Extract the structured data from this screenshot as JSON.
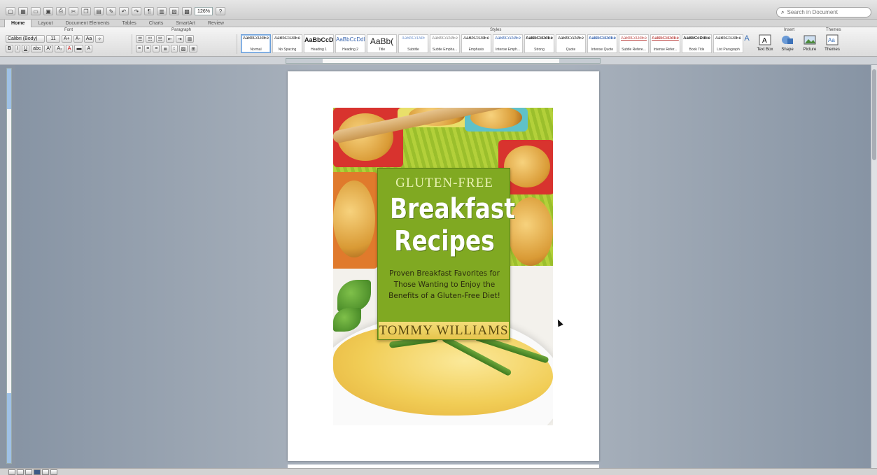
{
  "toolbar": {
    "zoom": "126%"
  },
  "search": {
    "placeholder": "Search in Document"
  },
  "ribbon": {
    "tabs": [
      "Home",
      "Layout",
      "Document Elements",
      "Tables",
      "Charts",
      "SmartArt",
      "Review"
    ],
    "groups": {
      "font": "Font",
      "paragraph": "Paragraph",
      "styles": "Styles",
      "insert": "Insert",
      "themes": "Themes"
    },
    "font_name": "Calibri (Body)",
    "font_size": "11",
    "styles": [
      {
        "sample": "AaBbCcDdEe",
        "name": "Normal"
      },
      {
        "sample": "AaBbCcDdEe",
        "name": "No Spacing"
      },
      {
        "sample": "AaBbCcDc",
        "name": "Heading 1"
      },
      {
        "sample": "AaBbCcDdI",
        "name": "Heading 2"
      },
      {
        "sample": "AaBb(",
        "name": "Title"
      },
      {
        "sample": "AaBbCcDdE",
        "name": "Subtitle"
      },
      {
        "sample": "AaBbCcDdEe",
        "name": "Subtle Empha..."
      },
      {
        "sample": "AaBbCcDdEe",
        "name": "Emphasis"
      },
      {
        "sample": "AaBbCcDdEe",
        "name": "Intense Emph..."
      },
      {
        "sample": "AaBbCcDdEe",
        "name": "Strong"
      },
      {
        "sample": "AaBbCcDdEe",
        "name": "Quote"
      },
      {
        "sample": "AaBbCcDdEe",
        "name": "Intense Quote"
      },
      {
        "sample": "AaBbCcDdEe",
        "name": "Subtle Refere..."
      },
      {
        "sample": "AaBbCcDdEe",
        "name": "Intense Refer..."
      },
      {
        "sample": "AaBbCcDdEe",
        "name": "Book Title"
      },
      {
        "sample": "AaBbCcDdEe",
        "name": "List Paragraph"
      }
    ],
    "insert": [
      "Text Box",
      "Shape",
      "Picture"
    ],
    "themes": "Themes"
  },
  "cover": {
    "kicker": "GLUTEN-FREE",
    "title_line1": "Breakfast",
    "title_line2": "Recipes",
    "subtitle": "Proven Breakfast Favorites for Those Wanting to Enjoy the Benefits of a Gluten-Free Diet!",
    "author": "TOMMY WILLIAMS"
  },
  "colors": {
    "accent_green": "#80a922",
    "author_band": "#e6c54c"
  },
  "icons": [
    "undo-icon",
    "redo-icon",
    "save-icon",
    "print-icon",
    "search-icon",
    "help-icon"
  ]
}
